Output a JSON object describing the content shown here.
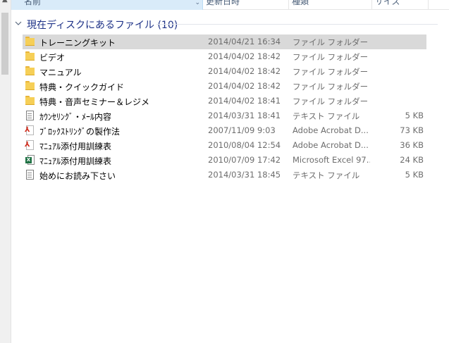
{
  "columns": {
    "name": "名前",
    "date": "更新日時",
    "type": "種類",
    "size": "サイズ"
  },
  "group": {
    "title": "現在ディスクにあるファイル (10)"
  },
  "files": [
    {
      "name": "トレーニングキット",
      "date": "2014/04/21 16:34",
      "type": "ファイル フォルダー",
      "size": "",
      "icon": "folder-icon",
      "selected": true
    },
    {
      "name": "ビデオ",
      "date": "2014/04/02 18:42",
      "type": "ファイル フォルダー",
      "size": "",
      "icon": "folder-icon"
    },
    {
      "name": "マニュアル",
      "date": "2014/04/02 18:42",
      "type": "ファイル フォルダー",
      "size": "",
      "icon": "folder-icon"
    },
    {
      "name": "特典・クイックガイド",
      "date": "2014/04/02 18:42",
      "type": "ファイル フォルダー",
      "size": "",
      "icon": "folder-icon"
    },
    {
      "name": "特典・音声セミナー＆レジメ",
      "date": "2014/04/02 18:41",
      "type": "ファイル フォルダー",
      "size": "",
      "icon": "folder-icon"
    },
    {
      "name": "ｶｳﾝｾﾘﾝｸﾞ・ﾒｰﾙ内容",
      "date": "2014/03/31 18:41",
      "type": "テキスト ファイル",
      "size": "5 KB",
      "icon": "text-file-icon"
    },
    {
      "name": "ﾌﾞﾛｯｸｽﾄﾘﾝｸﾞの製作法",
      "date": "2007/11/09 9:03",
      "type": "Adobe Acrobat D...",
      "size": "73 KB",
      "icon": "pdf-file-icon"
    },
    {
      "name": "ﾏﾆｭｱﾙ添付用訓練表",
      "date": "2010/08/04 12:54",
      "type": "Adobe Acrobat D...",
      "size": "36 KB",
      "icon": "pdf-file-icon"
    },
    {
      "name": "ﾏﾆｭｱﾙ添付用訓練表",
      "date": "2010/07/09 17:42",
      "type": "Microsoft Excel 97...",
      "size": "24 KB",
      "icon": "excel-file-icon"
    },
    {
      "name": "始めにお読み下さい",
      "date": "2014/03/31 18:45",
      "type": "テキスト ファイル",
      "size": "5 KB",
      "icon": "text-file-icon"
    }
  ],
  "colors": {
    "selected_row": "#d9d9d9",
    "group_title": "#1e3287",
    "secondary_text": "#6d6d6d",
    "folder": "#f6cf57",
    "header_active": "#d9ebf9"
  }
}
